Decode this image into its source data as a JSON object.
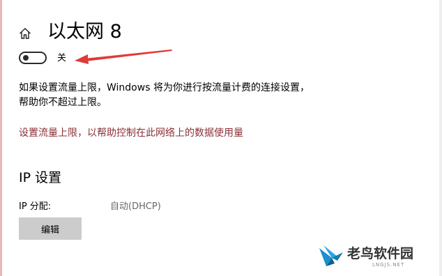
{
  "header": {
    "home_icon": "home-icon",
    "title": "以太网 8"
  },
  "metered_connection": {
    "toggle_state_label": "关",
    "toggle_on": false,
    "annotation_arrow_color": "#e03a3a",
    "description_lines": [
      "如果设置流量上限，Windows 将为你进行按流量计费的连接设置，",
      "帮助你不超过上限。"
    ],
    "data_limit_link": "设置流量上限，以帮助控制在此网络上的数据使用量",
    "link_color": "#8a2f36"
  },
  "ip_settings": {
    "section_title": "IP 设置",
    "assignment_label": "IP 分配:",
    "assignment_value": "自动(DHCP)",
    "edit_button_label": "编辑"
  },
  "watermark": {
    "logo_icon": "bird-logo-icon",
    "name": "老鸟软件园",
    "url": "LNGJS.NET"
  }
}
